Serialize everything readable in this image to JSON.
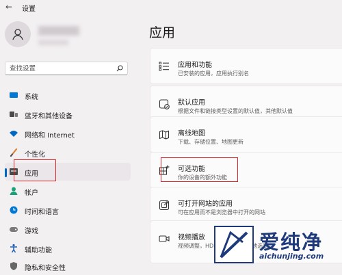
{
  "window": {
    "title": "设置",
    "back_icon": "back-arrow-icon"
  },
  "search": {
    "placeholder": "查找设置"
  },
  "sidebar": {
    "items": [
      {
        "label": "系统",
        "icon": "system-icon",
        "color": "#0078d4"
      },
      {
        "label": "蓝牙和其他设备",
        "icon": "bluetooth-icon",
        "color": "#555555"
      },
      {
        "label": "网络和 Internet",
        "icon": "wifi-icon",
        "color": "#0067c0"
      },
      {
        "label": "个性化",
        "icon": "brush-icon",
        "color": "#d98232"
      },
      {
        "label": "应用",
        "icon": "apps-icon",
        "color": "#555555",
        "active": true
      },
      {
        "label": "帐户",
        "icon": "account-icon",
        "color": "#1aa179"
      },
      {
        "label": "时间和语言",
        "icon": "globe-clock-icon",
        "color": "#0078d4"
      },
      {
        "label": "游戏",
        "icon": "gamepad-icon",
        "color": "#7a7a7a"
      },
      {
        "label": "辅助功能",
        "icon": "accessibility-icon",
        "color": "#1f5fb8"
      },
      {
        "label": "隐私和安全性",
        "icon": "shield-icon",
        "color": "#666666"
      }
    ]
  },
  "main": {
    "title": "应用",
    "cards": [
      {
        "title": "应用和功能",
        "desc": "已安装的应用，应用执行别名",
        "icon": "apps-list-icon"
      },
      {
        "title": "默认应用",
        "desc": "根据文件和链接类型设置的默认值，其他默认值",
        "icon": "default-app-icon"
      },
      {
        "title": "离线地图",
        "desc": "下载、存储位置、地图更新",
        "icon": "map-icon"
      },
      {
        "title": "可选功能",
        "desc": "你的设备的额外功能",
        "icon": "optional-features-icon"
      },
      {
        "title": "可打开网站的应用",
        "desc": "可在应用而不是浏览器中打开的网站",
        "icon": "open-web-icon"
      },
      {
        "title": "视频播放",
        "desc": "视频调整，HDR 流式处理，电池选项",
        "icon": "video-icon"
      }
    ]
  },
  "watermark": {
    "text_cn": "爱纯净",
    "text_en": "aichunjing.com"
  },
  "colors": {
    "accent": "#0067c0",
    "highlight": "#e0262b",
    "brand": "#1e3a7a"
  }
}
